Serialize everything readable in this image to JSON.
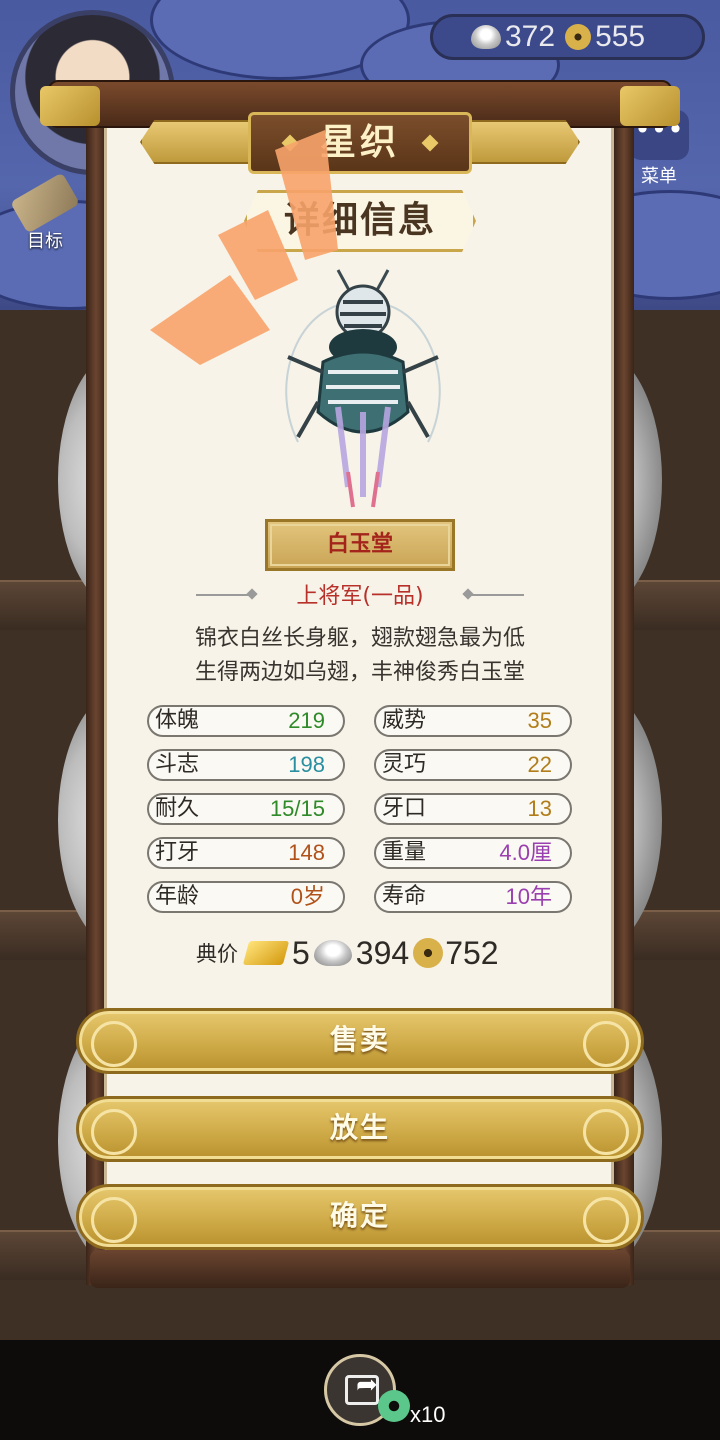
{
  "hud": {
    "silver": "372",
    "copper": "555",
    "goal_label": "目标",
    "menu_label": "菜单"
  },
  "panel": {
    "title": "星织",
    "section_title": "详细信息",
    "cricket_name": "白玉堂",
    "rank": "上将军(一品)",
    "description": [
      "锦衣白丝长身躯，翅款翅急最为低",
      "生得两边如乌翅，丰神俊秀白玉堂"
    ],
    "stats": [
      {
        "key": "体魄",
        "value": "219",
        "color": "#2f8a2a"
      },
      {
        "key": "威势",
        "value": "35",
        "color": "#b07d1a"
      },
      {
        "key": "斗志",
        "value": "198",
        "color": "#2a8fa0"
      },
      {
        "key": "灵巧",
        "value": "22",
        "color": "#b07d1a"
      },
      {
        "key": "耐久",
        "value": "15/15",
        "color": "#2f8a2a"
      },
      {
        "key": "牙口",
        "value": "13",
        "color": "#b07d1a"
      },
      {
        "key": "打牙",
        "value": "148",
        "color": "#b0521a"
      },
      {
        "key": "重量",
        "value": "4.0厘",
        "color": "#9a3fb0"
      },
      {
        "key": "年龄",
        "value": "0岁",
        "color": "#b0521a"
      },
      {
        "key": "寿命",
        "value": "10年",
        "color": "#9a3fb0"
      }
    ],
    "price": {
      "label": "典价",
      "gold": "5",
      "silver": "394",
      "copper": "752"
    }
  },
  "buttons": {
    "sell": "售卖",
    "release": "放生",
    "confirm": "确定"
  },
  "footer": {
    "share_count": "x10"
  }
}
